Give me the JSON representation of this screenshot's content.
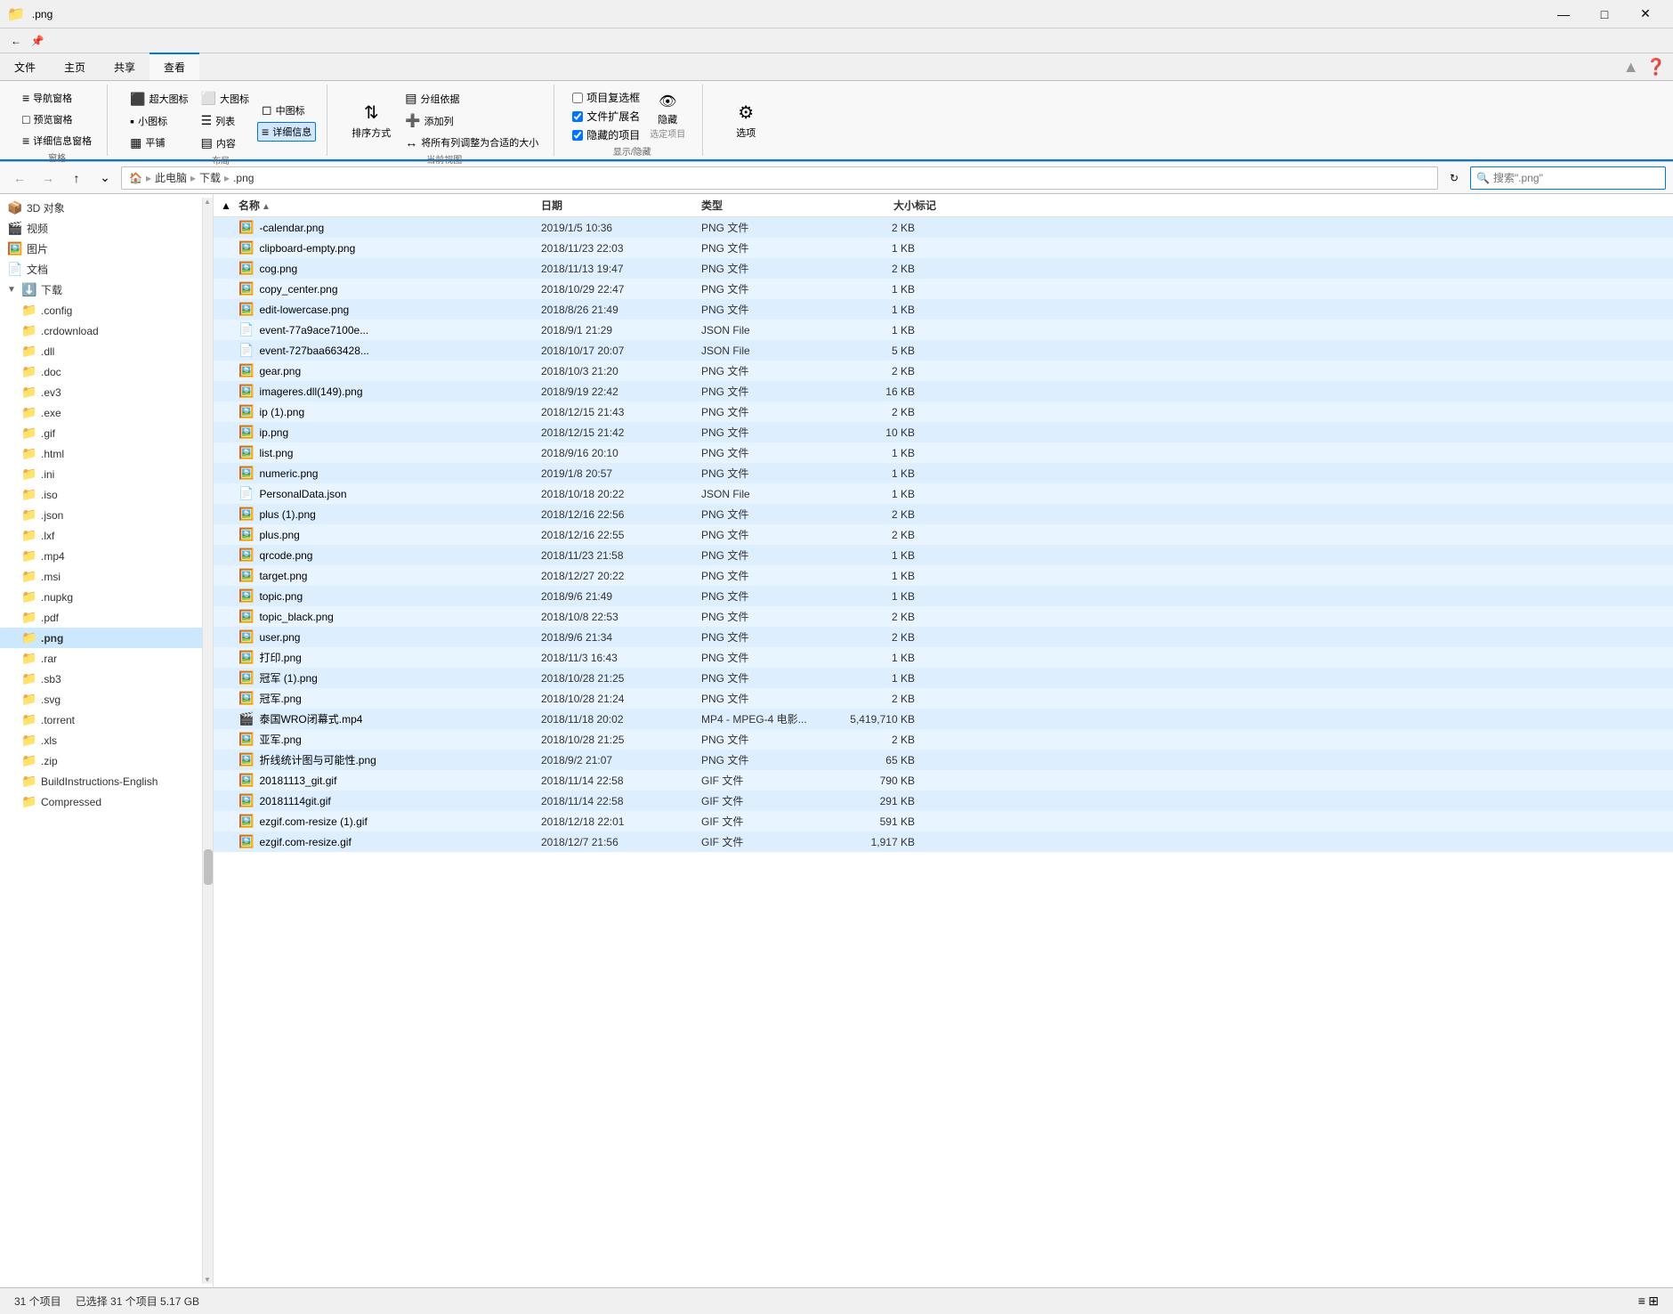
{
  "titleBar": {
    "title": ".png",
    "controls": [
      "─",
      "□",
      "✕"
    ]
  },
  "ribbon": {
    "tabs": [
      "文件",
      "主页",
      "共享",
      "查看"
    ],
    "activeTab": "查看",
    "groups": {
      "窗格": {
        "label": "窗格",
        "items": [
          "导航窗格",
          "预览窗格",
          "详细信息窗格"
        ]
      },
      "布局": {
        "label": "布局",
        "items": [
          "超大图标",
          "大图标",
          "中图标",
          "小图标",
          "列表",
          "详细信息",
          "平铺",
          "内容"
        ]
      },
      "当前视图": {
        "label": "当前视图",
        "items": [
          "排序方式",
          "分组依据",
          "添加列",
          "将所有列调整为合适的大小"
        ]
      },
      "显示/隐藏": {
        "label": "显示/隐藏",
        "items": [
          "项目复选框",
          "文件扩展名",
          "隐藏的项目",
          "隐藏 选定项目"
        ]
      },
      "选项": {
        "label": "",
        "items": [
          "选项"
        ]
      }
    }
  },
  "addressBar": {
    "pathItems": [
      "此电脑",
      "下载",
      ".png"
    ],
    "searchPlaceholder": "搜索\".png\"",
    "searchValue": "搜索\".png\""
  },
  "sidebar": {
    "items": [
      {
        "label": "3D 对象",
        "icon": "📦",
        "indent": 0
      },
      {
        "label": "视频",
        "icon": "🎬",
        "indent": 0
      },
      {
        "label": "图片",
        "icon": "🖼️",
        "indent": 0
      },
      {
        "label": "文档",
        "icon": "📄",
        "indent": 0
      },
      {
        "label": "下载",
        "icon": "⬇️",
        "indent": 0,
        "selected": true,
        "expanded": true
      },
      {
        "label": ".config",
        "icon": "📁",
        "indent": 1
      },
      {
        "label": ".crdownload",
        "icon": "📁",
        "indent": 1
      },
      {
        "label": ".dll",
        "icon": "📁",
        "indent": 1
      },
      {
        "label": ".doc",
        "icon": "📁",
        "indent": 1
      },
      {
        "label": ".ev3",
        "icon": "📁",
        "indent": 1
      },
      {
        "label": ".exe",
        "icon": "📁",
        "indent": 1
      },
      {
        "label": ".gif",
        "icon": "📁",
        "indent": 1
      },
      {
        "label": ".html",
        "icon": "📁",
        "indent": 1
      },
      {
        "label": ".ini",
        "icon": "📁",
        "indent": 1
      },
      {
        "label": ".iso",
        "icon": "📁",
        "indent": 1
      },
      {
        "label": ".json",
        "icon": "📁",
        "indent": 1
      },
      {
        "label": ".lxf",
        "icon": "📁",
        "indent": 1
      },
      {
        "label": ".mp4",
        "icon": "📁",
        "indent": 1
      },
      {
        "label": ".msi",
        "icon": "📁",
        "indent": 1
      },
      {
        "label": ".nupkg",
        "icon": "📁",
        "indent": 1
      },
      {
        "label": ".pdf",
        "icon": "📁",
        "indent": 1
      },
      {
        "label": ".png",
        "icon": "📁",
        "indent": 1,
        "selected": true
      },
      {
        "label": ".rar",
        "icon": "📁",
        "indent": 1
      },
      {
        "label": ".sb3",
        "icon": "📁",
        "indent": 1
      },
      {
        "label": ".svg",
        "icon": "📁",
        "indent": 1
      },
      {
        "label": ".torrent",
        "icon": "📁",
        "indent": 1
      },
      {
        "label": ".xls",
        "icon": "📁",
        "indent": 1
      },
      {
        "label": ".zip",
        "icon": "📁",
        "indent": 1
      },
      {
        "label": "BuildInstructions-English",
        "icon": "📁",
        "indent": 1
      },
      {
        "label": "Compressed",
        "icon": "📁",
        "indent": 1
      }
    ]
  },
  "fileList": {
    "columns": [
      {
        "id": "name",
        "label": "名称",
        "sortActive": true
      },
      {
        "id": "date",
        "label": "日期"
      },
      {
        "id": "type",
        "label": "类型"
      },
      {
        "id": "size",
        "label": "大小"
      },
      {
        "id": "tag",
        "label": "标记"
      }
    ],
    "files": [
      {
        "name": "-calendar.png",
        "date": "2019/1/5 10:36",
        "type": "PNG 文件",
        "size": "2 KB",
        "tag": "",
        "icon": "🖼️"
      },
      {
        "name": "clipboard-empty.png",
        "date": "2018/11/23 22:03",
        "type": "PNG 文件",
        "size": "1 KB",
        "tag": "",
        "icon": "🖼️"
      },
      {
        "name": "cog.png",
        "date": "2018/11/13 19:47",
        "type": "PNG 文件",
        "size": "2 KB",
        "tag": "",
        "icon": "🖼️"
      },
      {
        "name": "copy_center.png",
        "date": "2018/10/29 22:47",
        "type": "PNG 文件",
        "size": "1 KB",
        "tag": "",
        "icon": "🖼️"
      },
      {
        "name": "edit-lowercase.png",
        "date": "2018/8/26 21:49",
        "type": "PNG 文件",
        "size": "1 KB",
        "tag": "",
        "icon": "🖼️"
      },
      {
        "name": "event-77a9ace7100e...",
        "date": "2018/9/1 21:29",
        "type": "JSON File",
        "size": "1 KB",
        "tag": "",
        "icon": "📄"
      },
      {
        "name": "event-727baa663428...",
        "date": "2018/10/17 20:07",
        "type": "JSON File",
        "size": "5 KB",
        "tag": "",
        "icon": "📄"
      },
      {
        "name": "gear.png",
        "date": "2018/10/3 21:20",
        "type": "PNG 文件",
        "size": "2 KB",
        "tag": "",
        "icon": "🖼️"
      },
      {
        "name": "imageres.dll(149).png",
        "date": "2018/9/19 22:42",
        "type": "PNG 文件",
        "size": "16 KB",
        "tag": "",
        "icon": "🖼️"
      },
      {
        "name": "ip (1).png",
        "date": "2018/12/15 21:43",
        "type": "PNG 文件",
        "size": "2 KB",
        "tag": "",
        "icon": "🖼️"
      },
      {
        "name": "ip.png",
        "date": "2018/12/15 21:42",
        "type": "PNG 文件",
        "size": "10 KB",
        "tag": "",
        "icon": "🖼️"
      },
      {
        "name": "list.png",
        "date": "2018/9/16 20:10",
        "type": "PNG 文件",
        "size": "1 KB",
        "tag": "",
        "icon": "🖼️"
      },
      {
        "name": "numeric.png",
        "date": "2019/1/8 20:57",
        "type": "PNG 文件",
        "size": "1 KB",
        "tag": "",
        "icon": "🖼️"
      },
      {
        "name": "PersonalData.json",
        "date": "2018/10/18 20:22",
        "type": "JSON File",
        "size": "1 KB",
        "tag": "",
        "icon": "📄"
      },
      {
        "name": "plus (1).png",
        "date": "2018/12/16 22:56",
        "type": "PNG 文件",
        "size": "2 KB",
        "tag": "",
        "icon": "🖼️"
      },
      {
        "name": "plus.png",
        "date": "2018/12/16 22:55",
        "type": "PNG 文件",
        "size": "2 KB",
        "tag": "",
        "icon": "🖼️"
      },
      {
        "name": "qrcode.png",
        "date": "2018/11/23 21:58",
        "type": "PNG 文件",
        "size": "1 KB",
        "tag": "",
        "icon": "🖼️"
      },
      {
        "name": "target.png",
        "date": "2018/12/27 20:22",
        "type": "PNG 文件",
        "size": "1 KB",
        "tag": "",
        "icon": "🖼️"
      },
      {
        "name": "topic.png",
        "date": "2018/9/6 21:49",
        "type": "PNG 文件",
        "size": "1 KB",
        "tag": "",
        "icon": "🖼️"
      },
      {
        "name": "topic_black.png",
        "date": "2018/10/8 22:53",
        "type": "PNG 文件",
        "size": "2 KB",
        "tag": "",
        "icon": "🖼️"
      },
      {
        "name": "user.png",
        "date": "2018/9/6 21:34",
        "type": "PNG 文件",
        "size": "2 KB",
        "tag": "",
        "icon": "🖼️"
      },
      {
        "name": "打印.png",
        "date": "2018/11/3 16:43",
        "type": "PNG 文件",
        "size": "1 KB",
        "tag": "",
        "icon": "🖼️"
      },
      {
        "name": "冠军 (1).png",
        "date": "2018/10/28 21:25",
        "type": "PNG 文件",
        "size": "1 KB",
        "tag": "",
        "icon": "🖼️"
      },
      {
        "name": "冠军.png",
        "date": "2018/10/28 21:24",
        "type": "PNG 文件",
        "size": "2 KB",
        "tag": "",
        "icon": "🖼️"
      },
      {
        "name": "泰国WRO闭幕式.mp4",
        "date": "2018/11/18 20:02",
        "type": "MP4 - MPEG-4 电影...",
        "size": "5,419,710 KB",
        "tag": "",
        "icon": "🎬"
      },
      {
        "name": "亚军.png",
        "date": "2018/10/28 21:25",
        "type": "PNG 文件",
        "size": "2 KB",
        "tag": "",
        "icon": "🖼️"
      },
      {
        "name": "折线统计图与可能性.png",
        "date": "2018/9/2 21:07",
        "type": "PNG 文件",
        "size": "65 KB",
        "tag": "",
        "icon": "🖼️"
      },
      {
        "name": "20181113_git.gif",
        "date": "2018/11/14 22:58",
        "type": "GIF 文件",
        "size": "790 KB",
        "tag": "",
        "icon": "🖼️"
      },
      {
        "name": "20181114git.gif",
        "date": "2018/11/14 22:58",
        "type": "GIF 文件",
        "size": "291 KB",
        "tag": "",
        "icon": "🖼️"
      },
      {
        "name": "ezgif.com-resize (1).gif",
        "date": "2018/12/18 22:01",
        "type": "GIF 文件",
        "size": "591 KB",
        "tag": "",
        "icon": "🖼️"
      },
      {
        "name": "ezgif.com-resize.gif",
        "date": "2018/12/7 21:56",
        "type": "GIF 文件",
        "size": "1,917 KB",
        "tag": "",
        "icon": "🖼️"
      }
    ]
  },
  "statusBar": {
    "itemCount": "31 个项目",
    "selectedInfo": "已选择 31 个项目 5.17 GB"
  }
}
